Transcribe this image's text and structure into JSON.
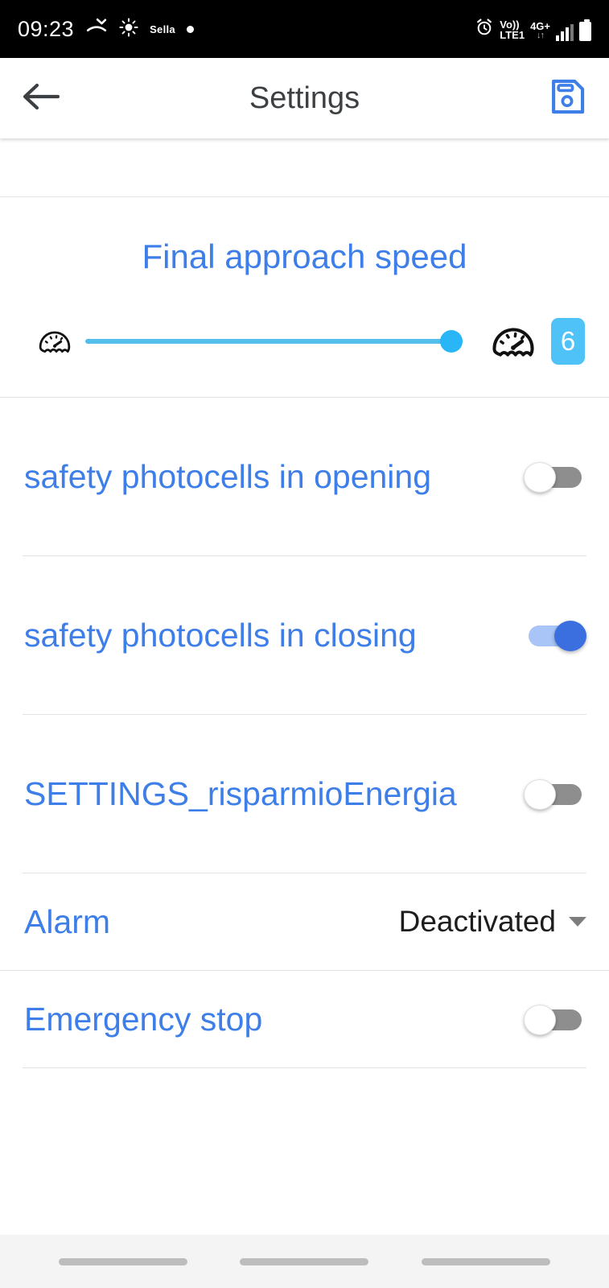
{
  "status_bar": {
    "time": "09:23",
    "missed_call_icon": "missed-call-icon",
    "brightness_icon": "brightness-icon",
    "carrier": "Sella",
    "dot_icon": "dot-icon",
    "alarm_icon": "alarm-clock-icon",
    "volte_line1": "Vo))",
    "volte_line2": "LTE1",
    "network_label": "4G+",
    "network_arrows": "↓↑",
    "signal_icon": "signal-bars-icon",
    "battery_icon": "battery-icon"
  },
  "app_bar": {
    "back_icon": "back-arrow-icon",
    "title": "Settings",
    "save_icon": "save-floppy-icon"
  },
  "slider_section": {
    "title": "Final approach speed",
    "min_icon": "speedometer-slow-icon",
    "max_icon": "speedometer-fast-icon",
    "value": "6",
    "fill_percent": 100,
    "track_color": "#53bdeb",
    "thumb_color": "#29b6f6",
    "badge_color": "#4fc3f7"
  },
  "rows": [
    {
      "label": "safety photocells in opening",
      "control": "toggle",
      "state": "off"
    },
    {
      "label": "safety photocells in closing",
      "control": "toggle",
      "state": "on"
    },
    {
      "label": "SETTINGS_risparmioEnergia",
      "control": "toggle",
      "state": "off"
    },
    {
      "label": "Alarm",
      "control": "dropdown",
      "value": "Deactivated"
    },
    {
      "label": "Emergency stop",
      "control": "toggle",
      "state": "off"
    }
  ],
  "nav_bar": {
    "pill_left": "nav-pill-left",
    "pill_center": "nav-pill-center",
    "pill_right": "nav-pill-right"
  },
  "colors": {
    "accent_blue": "#3d7ee8",
    "toggle_on_track": "#a9c4f7",
    "toggle_on_knob": "#3b6fe0",
    "toggle_off_track": "#8e8e8e"
  }
}
